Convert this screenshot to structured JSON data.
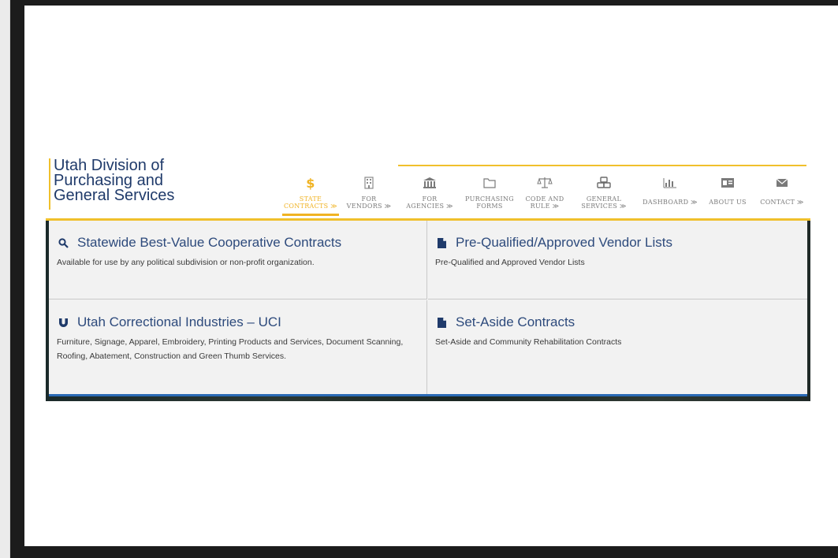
{
  "logo": {
    "line1": "Utah Division of",
    "line2": "Purchasing and",
    "line3": "General Services"
  },
  "nav": {
    "items": [
      {
        "line1": "State",
        "line2": "Contracts ≫",
        "icon": "dollar-icon",
        "active": true
      },
      {
        "line1": "For",
        "line2": "Vendors ≫",
        "icon": "building-icon"
      },
      {
        "line1": "For",
        "line2": "Agencies ≫",
        "icon": "bank-icon"
      },
      {
        "line1": "Purchasing",
        "line2": "Forms",
        "icon": "folder-icon"
      },
      {
        "line1": "Code and",
        "line2": "Rule ≫",
        "icon": "scales-icon"
      },
      {
        "line1": "General",
        "line2": "Services ≫",
        "icon": "cubes-icon"
      },
      {
        "line1": "Dashboard ≫",
        "line2": "",
        "icon": "bar-chart-icon"
      },
      {
        "line1": "About Us",
        "line2": "",
        "icon": "id-card-icon"
      },
      {
        "line1": "Contact ≫",
        "line2": "",
        "icon": "envelope-icon"
      }
    ]
  },
  "dropdown": {
    "cells": [
      {
        "title": "Statewide Best-Value Cooperative Contracts",
        "desc": "Available for use by any political subdivision or non-profit organization.",
        "icon": "search-icon"
      },
      {
        "title": "Pre-Qualified/Approved Vendor Lists",
        "desc": "Pre-Qualified and Approved Vendor Lists",
        "icon": "document-icon"
      },
      {
        "title": "Utah Correctional Industries – UCI",
        "desc": "Furniture, Signage, Apparel, Embroidery, Printing Products and Services, Document Scanning, Roofing, Abatement, Construction and Green Thumb Services.",
        "icon": "magnet-icon"
      },
      {
        "title": "Set-Aside Contracts",
        "desc": "Set-Aside and Community Rehabilitation Contracts",
        "icon": "document-icon"
      }
    ]
  },
  "colors": {
    "brand_navy": "#1f3a6a",
    "accent_gold": "#f0b323",
    "nav_gray": "#7a7a7a",
    "link_blue": "#2d4a7c"
  }
}
